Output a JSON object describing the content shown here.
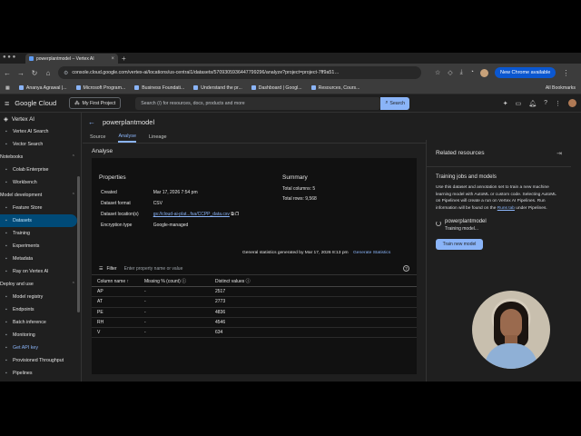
{
  "browser": {
    "tab_title": "powerplantmodel – Vertex AI",
    "url": "console.cloud.google.com/vertex-ai/locations/us-central1/datasets/5709305936447799296/analyze?project=project-7ff9a51…",
    "new_chrome_label": "New Chrome available",
    "bookmarks": [
      "Ananya Agrawal |...",
      "Microsoft Program...",
      "Business Foundati...",
      "Understand the pr...",
      "Dashboard | Googl...",
      "Resources, Cours..."
    ],
    "all_bookmarks": "All Bookmarks"
  },
  "gcp": {
    "logo": "Google Cloud",
    "project": "My First Project",
    "search_placeholder": "Search (/) for resources, docs, products and more",
    "search_button": "Search"
  },
  "sidebar": {
    "title": "Vertex AI",
    "items": [
      {
        "label": "Vertex AI Search",
        "type": "item"
      },
      {
        "label": "Vector Search",
        "type": "item"
      },
      {
        "label": "Notebooks",
        "type": "section"
      },
      {
        "label": "Colab Enterprise",
        "type": "item"
      },
      {
        "label": "Workbench",
        "type": "item"
      },
      {
        "label": "Model development",
        "type": "section"
      },
      {
        "label": "Feature Store",
        "type": "item"
      },
      {
        "label": "Datasets",
        "type": "active"
      },
      {
        "label": "Training",
        "type": "item"
      },
      {
        "label": "Experiments",
        "type": "item"
      },
      {
        "label": "Metadata",
        "type": "item"
      },
      {
        "label": "Ray on Vertex AI",
        "type": "item"
      },
      {
        "label": "Deploy and use",
        "type": "section"
      },
      {
        "label": "Model registry",
        "type": "item"
      },
      {
        "label": "Endpoints",
        "type": "item"
      },
      {
        "label": "Batch inference",
        "type": "item"
      },
      {
        "label": "Monitoring",
        "type": "item"
      },
      {
        "label": "Get API key",
        "type": "link"
      },
      {
        "label": "Provisioned Throughput",
        "type": "item"
      },
      {
        "label": "Pipelines",
        "type": "item"
      }
    ]
  },
  "main": {
    "title": "powerplantmodel",
    "tabs": [
      "Source",
      "Analyse",
      "Lineage"
    ],
    "section": "Analyse",
    "properties": {
      "heading": "Properties",
      "rows": [
        {
          "k": "Created",
          "v": "Mar 17, 2026 7:54 pm"
        },
        {
          "k": "Dataset format",
          "v": "CSV"
        },
        {
          "k": "Dataset location(s)",
          "v": "gs://cloud-ai-plat...fsa/CCPP_data.csv"
        },
        {
          "k": "Encryption type",
          "v": "Google-managed"
        }
      ]
    },
    "summary": {
      "heading": "Summary",
      "total_columns": "Total columns: 5",
      "total_rows": "Total rows: 9,568"
    },
    "general_stats": "General statistics generated by Mar 17, 2026 8:13 pm",
    "generate_button": "Generate Statistics",
    "filter_label": "Filter",
    "filter_placeholder": "Enter property name or value",
    "table": {
      "headers": [
        "Column name",
        "Missing % (count)",
        "Distinct values"
      ],
      "rows": [
        [
          "AP",
          "-",
          "2517"
        ],
        [
          "AT",
          "-",
          "2773"
        ],
        [
          "PE",
          "-",
          "4836"
        ],
        [
          "RH",
          "-",
          "4546"
        ],
        [
          "V",
          "-",
          "634"
        ]
      ]
    }
  },
  "related": {
    "title": "Related resources",
    "subtitle": "Training jobs and models",
    "desc_1": "Use this dataset and annotation set to train a new machine learning model with AutoML or custom code. Selecting AutoML on Pipelines will create a run on Vertex AI Pipelines. Run information will be found on the ",
    "desc_link": "Runs tab",
    "desc_2": " under Pipelines.",
    "job_name": "powerplantmodel",
    "job_status": "Training model...",
    "train_button": "Train new model"
  }
}
